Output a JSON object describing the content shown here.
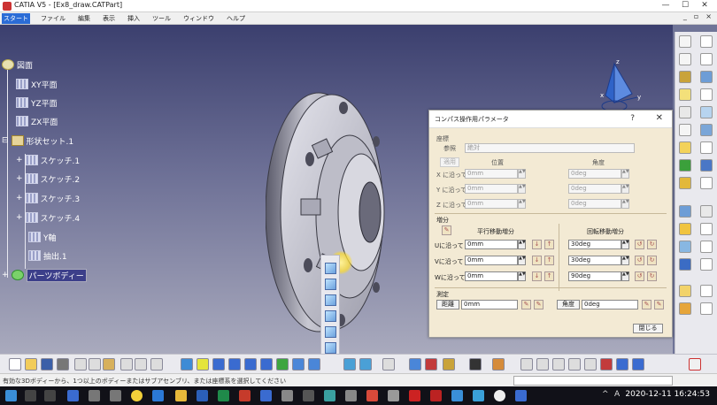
{
  "window": {
    "title": "CATIA V5 - [Ex8_draw.CATPart]",
    "min": "—",
    "max": "☐",
    "close": "✕"
  },
  "menu": [
    "スタート",
    "ファイル",
    "編集",
    "表示",
    "挿入",
    "ツール",
    "ウィンドウ",
    "ヘルプ"
  ],
  "menu_right": [
    "_",
    "▫",
    "×"
  ],
  "tree": {
    "root": "図面",
    "planes": [
      "XY平面",
      "YZ平面",
      "ZX平面"
    ],
    "geoset": "形状セット.1",
    "sketches": [
      "スケッチ.1",
      "スケッチ.2",
      "スケッチ.3",
      "スケッチ.4"
    ],
    "axis": "Y軸",
    "extrude": "抽出.1",
    "partbody": "パーツボディー"
  },
  "compass_labels": {
    "z": "z",
    "x": "x",
    "y": "y"
  },
  "dialog": {
    "title": "コンパス操作用パラメータ",
    "help": "?",
    "close": "✕",
    "coords_section": "座標",
    "reference_label": "参照",
    "reference_value": "絶対",
    "apply_btn": "適用",
    "pos_header": "位置",
    "angle_header": "角度",
    "axes_labels": [
      "X に沿って",
      "Y に沿って",
      "Z に沿って"
    ],
    "pos_values": [
      "0mm",
      "0mm",
      "0mm"
    ],
    "angle_values": [
      "0deg",
      "0deg",
      "0deg"
    ],
    "inc_section": "増分",
    "trans_header": "平行移動増分",
    "rot_header": "回転移動増分",
    "inc_labels": [
      "Uに沿って",
      "Vに沿って",
      "Wに沿って"
    ],
    "trans_values": [
      "0mm",
      "0mm",
      "0mm"
    ],
    "rot_values": [
      "30deg",
      "30deg",
      "90deg"
    ],
    "measure_section": "測定",
    "distance_btn": "距離",
    "distance_value": "0mm",
    "angle_btn": "角度",
    "angle_value": "0deg",
    "close_btn": "閉じる"
  },
  "status_msg": "有効な3Dボディーから、1つ以上のボディーまたはサブアセンブリ、または座標系を選択してください",
  "taskbar": {
    "clock": "2020-12-11 16:24:53",
    "tray_up": "^",
    "lang": "A"
  },
  "colors": {
    "viewport_top": "#3b3f6e",
    "viewport_bottom": "#a9aabd",
    "dialog_bg": "#f3ead4",
    "accent": "#2b6cd6"
  }
}
